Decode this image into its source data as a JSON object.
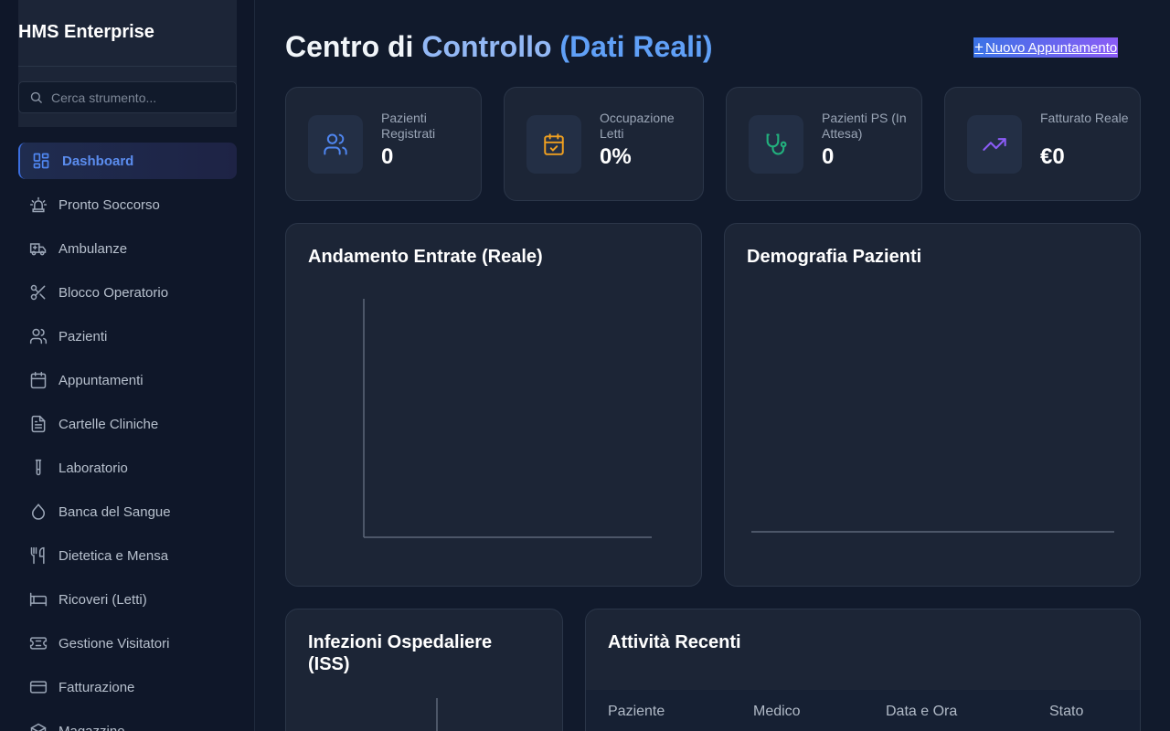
{
  "app": {
    "name": "HMS Enterprise"
  },
  "search": {
    "placeholder": "Cerca strumento..."
  },
  "sidebar": {
    "items": [
      {
        "label": "Dashboard",
        "icon": "dashboard-icon",
        "active": true
      },
      {
        "label": "Pronto Soccorso",
        "icon": "siren-icon"
      },
      {
        "label": "Ambulanze",
        "icon": "ambulance-icon"
      },
      {
        "label": "Blocco Operatorio",
        "icon": "scissors-icon"
      },
      {
        "label": "Pazienti",
        "icon": "users-icon"
      },
      {
        "label": "Appuntamenti",
        "icon": "calendar-icon"
      },
      {
        "label": "Cartelle Cliniche",
        "icon": "file-text-icon"
      },
      {
        "label": "Laboratorio",
        "icon": "test-tube-icon"
      },
      {
        "label": "Banca del Sangue",
        "icon": "droplet-icon"
      },
      {
        "label": "Dietetica e Mensa",
        "icon": "utensils-icon"
      },
      {
        "label": "Ricoveri (Letti)",
        "icon": "bed-icon"
      },
      {
        "label": "Gestione Visitatori",
        "icon": "ticket-icon"
      },
      {
        "label": "Fatturazione",
        "icon": "credit-card-icon"
      },
      {
        "label": "Magazzino",
        "icon": "package-icon"
      }
    ]
  },
  "header": {
    "title_part1": "Centro di ",
    "title_part2": "Controllo",
    "title_part3": " (Dati Reali)",
    "new_button": "Nuovo Appuntamento"
  },
  "stats": [
    {
      "label": "Pazienti Registrati",
      "value": "0",
      "icon": "users-icon",
      "color": "#4f86f0"
    },
    {
      "label": "Occupazione Letti",
      "value": "0%",
      "icon": "calendar-check-icon",
      "color": "#f0a020"
    },
    {
      "label": "Pazienti PS (In Attesa)",
      "value": "0",
      "icon": "stethoscope-icon",
      "color": "#22b07d"
    },
    {
      "label": "Fatturato Reale",
      "value": "€0",
      "icon": "trending-up-icon",
      "color": "#8b5cf6"
    }
  ],
  "panels": {
    "revenue": {
      "title": "Andamento Entrate (Reale)"
    },
    "demographics": {
      "title": "Demografia Pazienti"
    },
    "infections": {
      "title": "Infezioni Ospedaliere (ISS)"
    },
    "activity": {
      "title": "Attività Recenti",
      "columns": [
        "Paziente",
        "Medico",
        "Data e Ora",
        "Stato"
      ]
    }
  },
  "chart_data": [
    {
      "type": "line",
      "title": "Andamento Entrate (Reale)",
      "series": [],
      "values": []
    },
    {
      "type": "pie",
      "title": "Demografia Pazienti",
      "values": []
    },
    {
      "type": "bar",
      "title": "Infezioni Ospedaliere (ISS)",
      "values": []
    }
  ],
  "colors": {
    "accent": "#5b8def",
    "background": "#111a2c",
    "card": "#1c2536"
  }
}
